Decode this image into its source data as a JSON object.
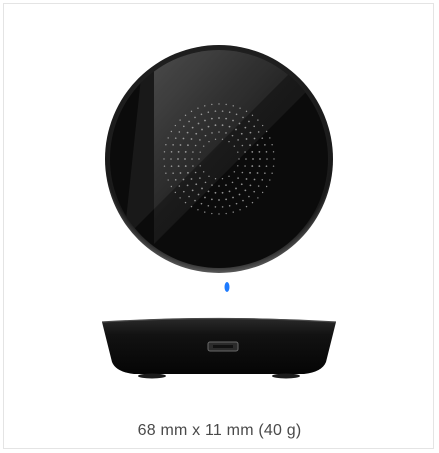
{
  "product": {
    "image_alt": "Wireless charging pad, top and side view",
    "dimensions_caption": "68 mm x 11 mm (40 g)",
    "led_color": "#1e7bff"
  },
  "colors": {
    "border": "#e4e4e4",
    "pad_body": "#0b0b0b",
    "caption_text": "#4a4a4a"
  }
}
